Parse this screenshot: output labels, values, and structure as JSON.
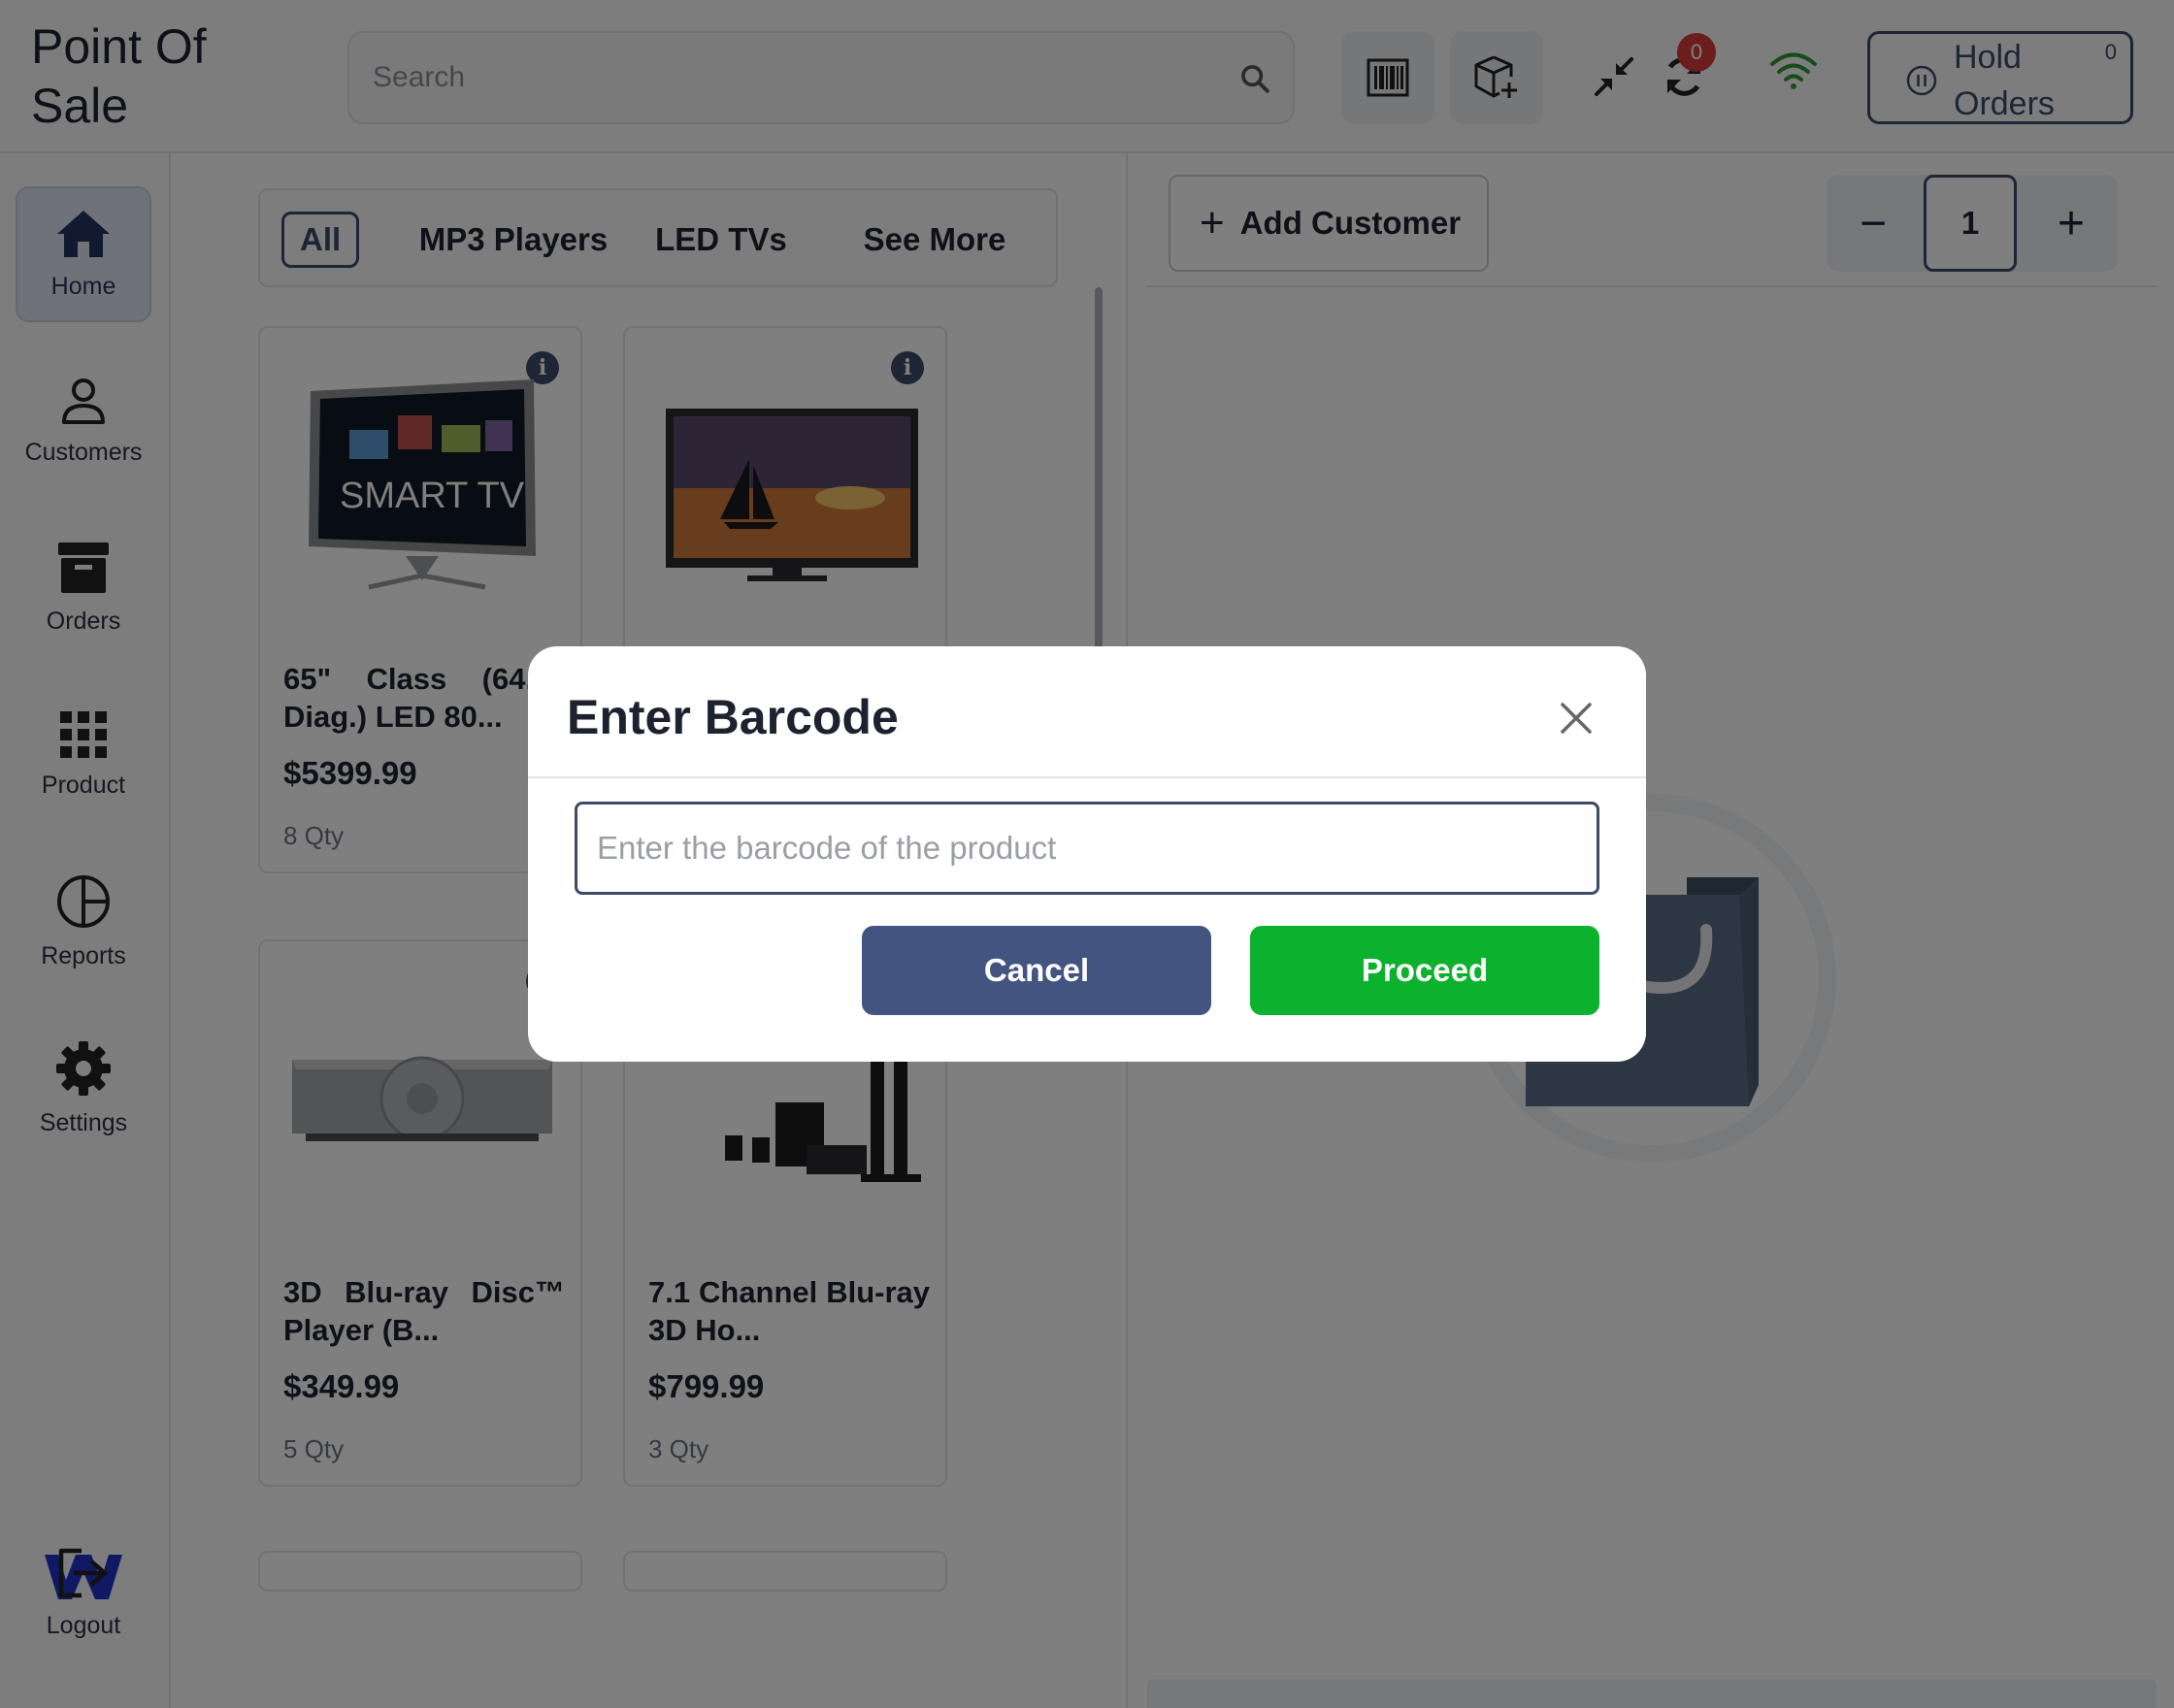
{
  "header": {
    "title": "Point Of Sale",
    "search_placeholder": "Search",
    "sync_badge": "0",
    "hold_orders_label": "Hold Orders",
    "hold_orders_count": "0"
  },
  "sidebar": {
    "items": [
      {
        "label": "Home",
        "icon": "home-icon"
      },
      {
        "label": "Customers",
        "icon": "user-icon"
      },
      {
        "label": "Orders",
        "icon": "archive-icon"
      },
      {
        "label": "Product",
        "icon": "grid-icon"
      },
      {
        "label": "Reports",
        "icon": "pie-chart-icon"
      },
      {
        "label": "Settings",
        "icon": "gear-icon"
      }
    ],
    "logout_label": "Logout"
  },
  "categories": [
    "All",
    "MP3 Players",
    "LED TVs",
    "See More"
  ],
  "products": [
    {
      "name": "65\" Class (64.5\" Diag.) LED 80...",
      "price": "$5399.99",
      "qty": "8 Qty"
    },
    {
      "name": "",
      "price": "",
      "qty": ""
    },
    {
      "name": "3D Blu-ray Disc™ Player (B...",
      "price": "$349.99",
      "qty": "5 Qty"
    },
    {
      "name": "7.1 Channel Blu-ray 3D Ho...",
      "price": "$799.99",
      "qty": "3 Qty"
    }
  ],
  "cart": {
    "add_customer_label": "Add Customer",
    "quantity": "1"
  },
  "modal": {
    "title": "Enter Barcode",
    "input_placeholder": "Enter the barcode of the product",
    "cancel_label": "Cancel",
    "proceed_label": "Proceed"
  },
  "colors": {
    "primary": "#3d4a6b",
    "proceed": "#0cb12e",
    "cancel": "#435480",
    "badge": "#d83a3a",
    "wifi": "#2e9d2e"
  }
}
